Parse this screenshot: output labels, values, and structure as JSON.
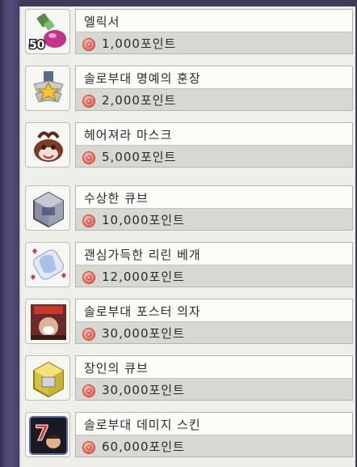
{
  "shop": {
    "items": [
      {
        "name": "엘릭서",
        "price": "1,000포인트",
        "icon": "elixir-icon",
        "badge": "50"
      },
      {
        "name": "솔로부대 명예의 훈장",
        "price": "2,000포인트",
        "icon": "medal-icon"
      },
      {
        "name": "헤어져라 마스크",
        "price": "5,000포인트",
        "icon": "mask-icon"
      },
      {
        "name": "수상한 큐브",
        "price": "10,000포인트",
        "icon": "suspicious-cube-icon"
      },
      {
        "name": "괜심가득한 리린 베개",
        "price": "12,000포인트",
        "icon": "rilin-pillow-icon"
      },
      {
        "name": "솔로부대 포스터 의자",
        "price": "30,000포인트",
        "icon": "poster-chair-icon"
      },
      {
        "name": "장인의 큐브",
        "price": "30,000포인트",
        "icon": "master-cube-icon"
      },
      {
        "name": "솔로부대 데미지 스킨",
        "price": "60,000포인트",
        "icon": "damage-skin-icon"
      }
    ]
  },
  "colors": {
    "coin": "#e06a5c",
    "panel": "#efefe9",
    "frame": "#3d3a5c"
  }
}
